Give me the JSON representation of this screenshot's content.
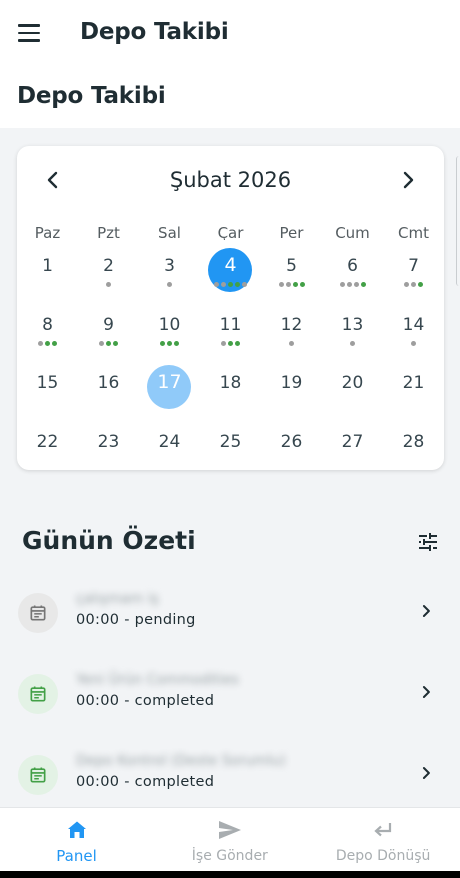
{
  "app": {
    "title": "Depo Takibi"
  },
  "page": {
    "title": "Depo Takibi"
  },
  "calendar": {
    "month_label": "Şubat 2026",
    "weekdays": [
      "Paz",
      "Pzt",
      "Sal",
      "Çar",
      "Per",
      "Cum",
      "Cmt"
    ],
    "weeks": [
      [
        {
          "day": "1",
          "dots": []
        },
        {
          "day": "2",
          "dots": [
            "g"
          ]
        },
        {
          "day": "3",
          "dots": [
            "g"
          ]
        },
        {
          "day": "4",
          "state": "today",
          "dots": [
            "g",
            "g",
            "s",
            "s",
            "g"
          ]
        },
        {
          "day": "5",
          "dots": [
            "g",
            "g",
            "s",
            "s"
          ]
        },
        {
          "day": "6",
          "dots": [
            "g",
            "g",
            "g",
            "s"
          ]
        },
        {
          "day": "7",
          "dots": [
            "g",
            "g",
            "s"
          ]
        }
      ],
      [
        {
          "day": "8",
          "dots": [
            "g",
            "s",
            "s"
          ]
        },
        {
          "day": "9",
          "dots": [
            "g",
            "s",
            "s"
          ]
        },
        {
          "day": "10",
          "dots": [
            "s",
            "s",
            "s"
          ]
        },
        {
          "day": "11",
          "dots": [
            "g",
            "s",
            "s"
          ]
        },
        {
          "day": "12",
          "dots": [
            "g"
          ]
        },
        {
          "day": "13",
          "dots": [
            "g"
          ]
        },
        {
          "day": "14",
          "dots": [
            "g"
          ]
        }
      ],
      [
        {
          "day": "15",
          "dots": []
        },
        {
          "day": "16",
          "dots": []
        },
        {
          "day": "17",
          "state": "selected",
          "dots": []
        },
        {
          "day": "18",
          "dots": []
        },
        {
          "day": "19",
          "dots": []
        },
        {
          "day": "20",
          "dots": []
        },
        {
          "day": "21",
          "dots": []
        }
      ],
      [
        {
          "day": "22",
          "dots": []
        },
        {
          "day": "23",
          "dots": []
        },
        {
          "day": "24",
          "dots": []
        },
        {
          "day": "25",
          "dots": []
        },
        {
          "day": "26",
          "dots": []
        },
        {
          "day": "27",
          "dots": []
        },
        {
          "day": "28",
          "dots": []
        }
      ]
    ],
    "colors": {
      "today": "#2196f3",
      "selected": "#90caf9",
      "dot_grey": "#9e9e9e",
      "dot_green": "#43a047"
    },
    "icons": {
      "prev": "chevron-left-icon",
      "next": "chevron-right-icon"
    }
  },
  "summary": {
    "title": "Günün Özeti",
    "filter_icon": "tune-icon",
    "events": [
      {
        "name": "çalışmam iş",
        "subtitle": "00:00 - pending",
        "status": "pending"
      },
      {
        "name": "Yeni Ürün Commodities",
        "subtitle": "00:00 - completed",
        "status": "completed"
      },
      {
        "name": "Depo Kontrol (Deste Sorumlu)",
        "subtitle": "00:00 - completed",
        "status": "completed"
      }
    ]
  },
  "bottom_nav": {
    "items": [
      {
        "label": "Panel",
        "icon": "home-icon",
        "active": true
      },
      {
        "label": "İşe Gönder",
        "icon": "send-icon",
        "active": false
      },
      {
        "label": "Depo Dönüşü",
        "icon": "return-icon",
        "active": false
      }
    ],
    "active_color": "#2196f3"
  }
}
